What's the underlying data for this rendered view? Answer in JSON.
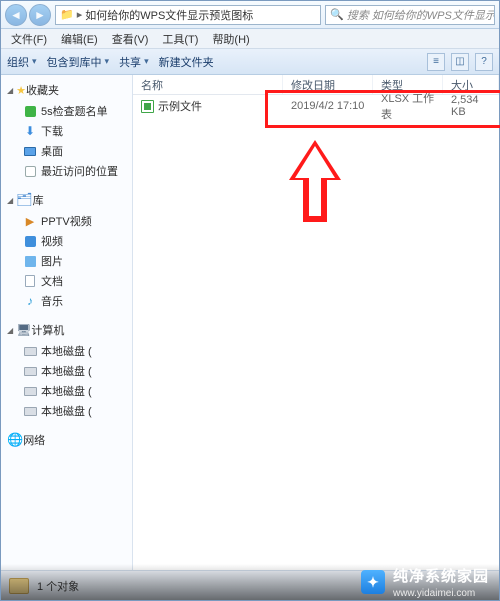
{
  "breadcrumb": {
    "folder": "如何给你的WPS文件显示预览图标"
  },
  "search": {
    "placeholder": "搜索 如何给你的WPS文件显示预览图..."
  },
  "menu": {
    "file": "文件(F)",
    "edit": "编辑(E)",
    "view": "查看(V)",
    "tools": "工具(T)",
    "help": "帮助(H)"
  },
  "toolbar": {
    "organize": "组织",
    "include": "包含到库中",
    "share": "共享",
    "newfolder": "新建文件夹"
  },
  "sidebar": {
    "fav_header": "收藏夹",
    "fav_items": [
      {
        "label": "5s检查题名单"
      },
      {
        "label": "下载"
      },
      {
        "label": "桌面"
      },
      {
        "label": "最近访问的位置"
      }
    ],
    "lib_header": "库",
    "lib_items": [
      {
        "label": "PPTV视频"
      },
      {
        "label": "视频"
      },
      {
        "label": "图片"
      },
      {
        "label": "文档"
      },
      {
        "label": "音乐"
      }
    ],
    "pc_header": "计算机",
    "pc_items": [
      {
        "label": "本地磁盘 ("
      },
      {
        "label": "本地磁盘 ("
      },
      {
        "label": "本地磁盘 ("
      },
      {
        "label": "本地磁盘 ("
      }
    ],
    "net_header": "网络"
  },
  "columns": {
    "name": "名称",
    "date": "修改日期",
    "type": "类型",
    "size": "大小"
  },
  "files": [
    {
      "name": "示例文件",
      "date": "2019/4/2 17:10",
      "type": "XLSX 工作表",
      "size": "2,534 KB"
    }
  ],
  "status": {
    "count": "1 个对象"
  },
  "watermark": {
    "brand": "纯净系统家园",
    "url": "www.yidaimei.com"
  }
}
